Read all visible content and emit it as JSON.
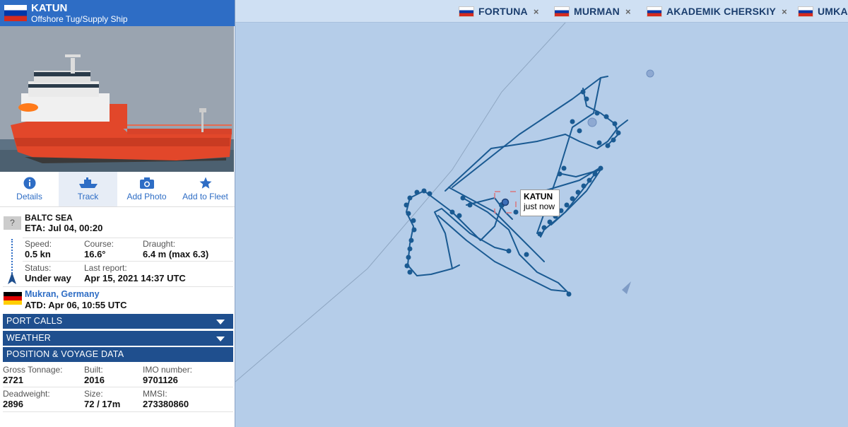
{
  "vessel": {
    "name": "KATUN",
    "type": "Offshore Tug/Supply Ship"
  },
  "actions": [
    {
      "label": "Details",
      "icon": "info-icon"
    },
    {
      "label": "Track",
      "icon": "ship-track-icon",
      "active": true
    },
    {
      "label": "Add Photo",
      "icon": "camera-icon"
    },
    {
      "label": "Add to Fleet",
      "icon": "star-icon"
    }
  ],
  "voyage": {
    "destination_badge": "?",
    "destination": "BALTC SEA",
    "eta": "ETA: Jul 04, 00:20",
    "speed_label": "Speed:",
    "speed": "0.5 kn",
    "course_label": "Course:",
    "course": "16.6°",
    "draught_label": "Draught:",
    "draught": "6.4 m (max 6.3)",
    "status_label": "Status:",
    "status": "Under way",
    "last_report_label": "Last report:",
    "last_report": "Apr 15, 2021 14:37 UTC",
    "departure_port": "Mukran, Germany",
    "atd": "ATD: Apr 06, 10:55 UTC"
  },
  "sections": {
    "port_calls": "PORT CALLS",
    "weather": "WEATHER",
    "position_voyage": "POSITION & VOYAGE DATA"
  },
  "particulars": {
    "gross_tonnage_label": "Gross Tonnage:",
    "gross_tonnage": "2721",
    "built_label": "Built:",
    "built": "2016",
    "imo_label": "IMO number:",
    "imo": "9701126",
    "deadweight_label": "Deadweight:",
    "deadweight": "2896",
    "size_label": "Size:",
    "size": "72 / 17m",
    "mmsi_label": "MMSI:",
    "mmsi": "273380860"
  },
  "tabs": [
    {
      "name": "FORTUNA"
    },
    {
      "name": "MURMAN"
    },
    {
      "name": "AKADEMIK CHERSKIY"
    },
    {
      "name": "UMKA"
    }
  ],
  "tab_close_glyph": "×",
  "tooltip": {
    "name": "KATUN",
    "time": "just now"
  },
  "colors": {
    "header_blue": "#2e6dc5",
    "section_navy": "#1f4f8e",
    "sea": "#b5cde9",
    "track": "#1a5a92"
  }
}
